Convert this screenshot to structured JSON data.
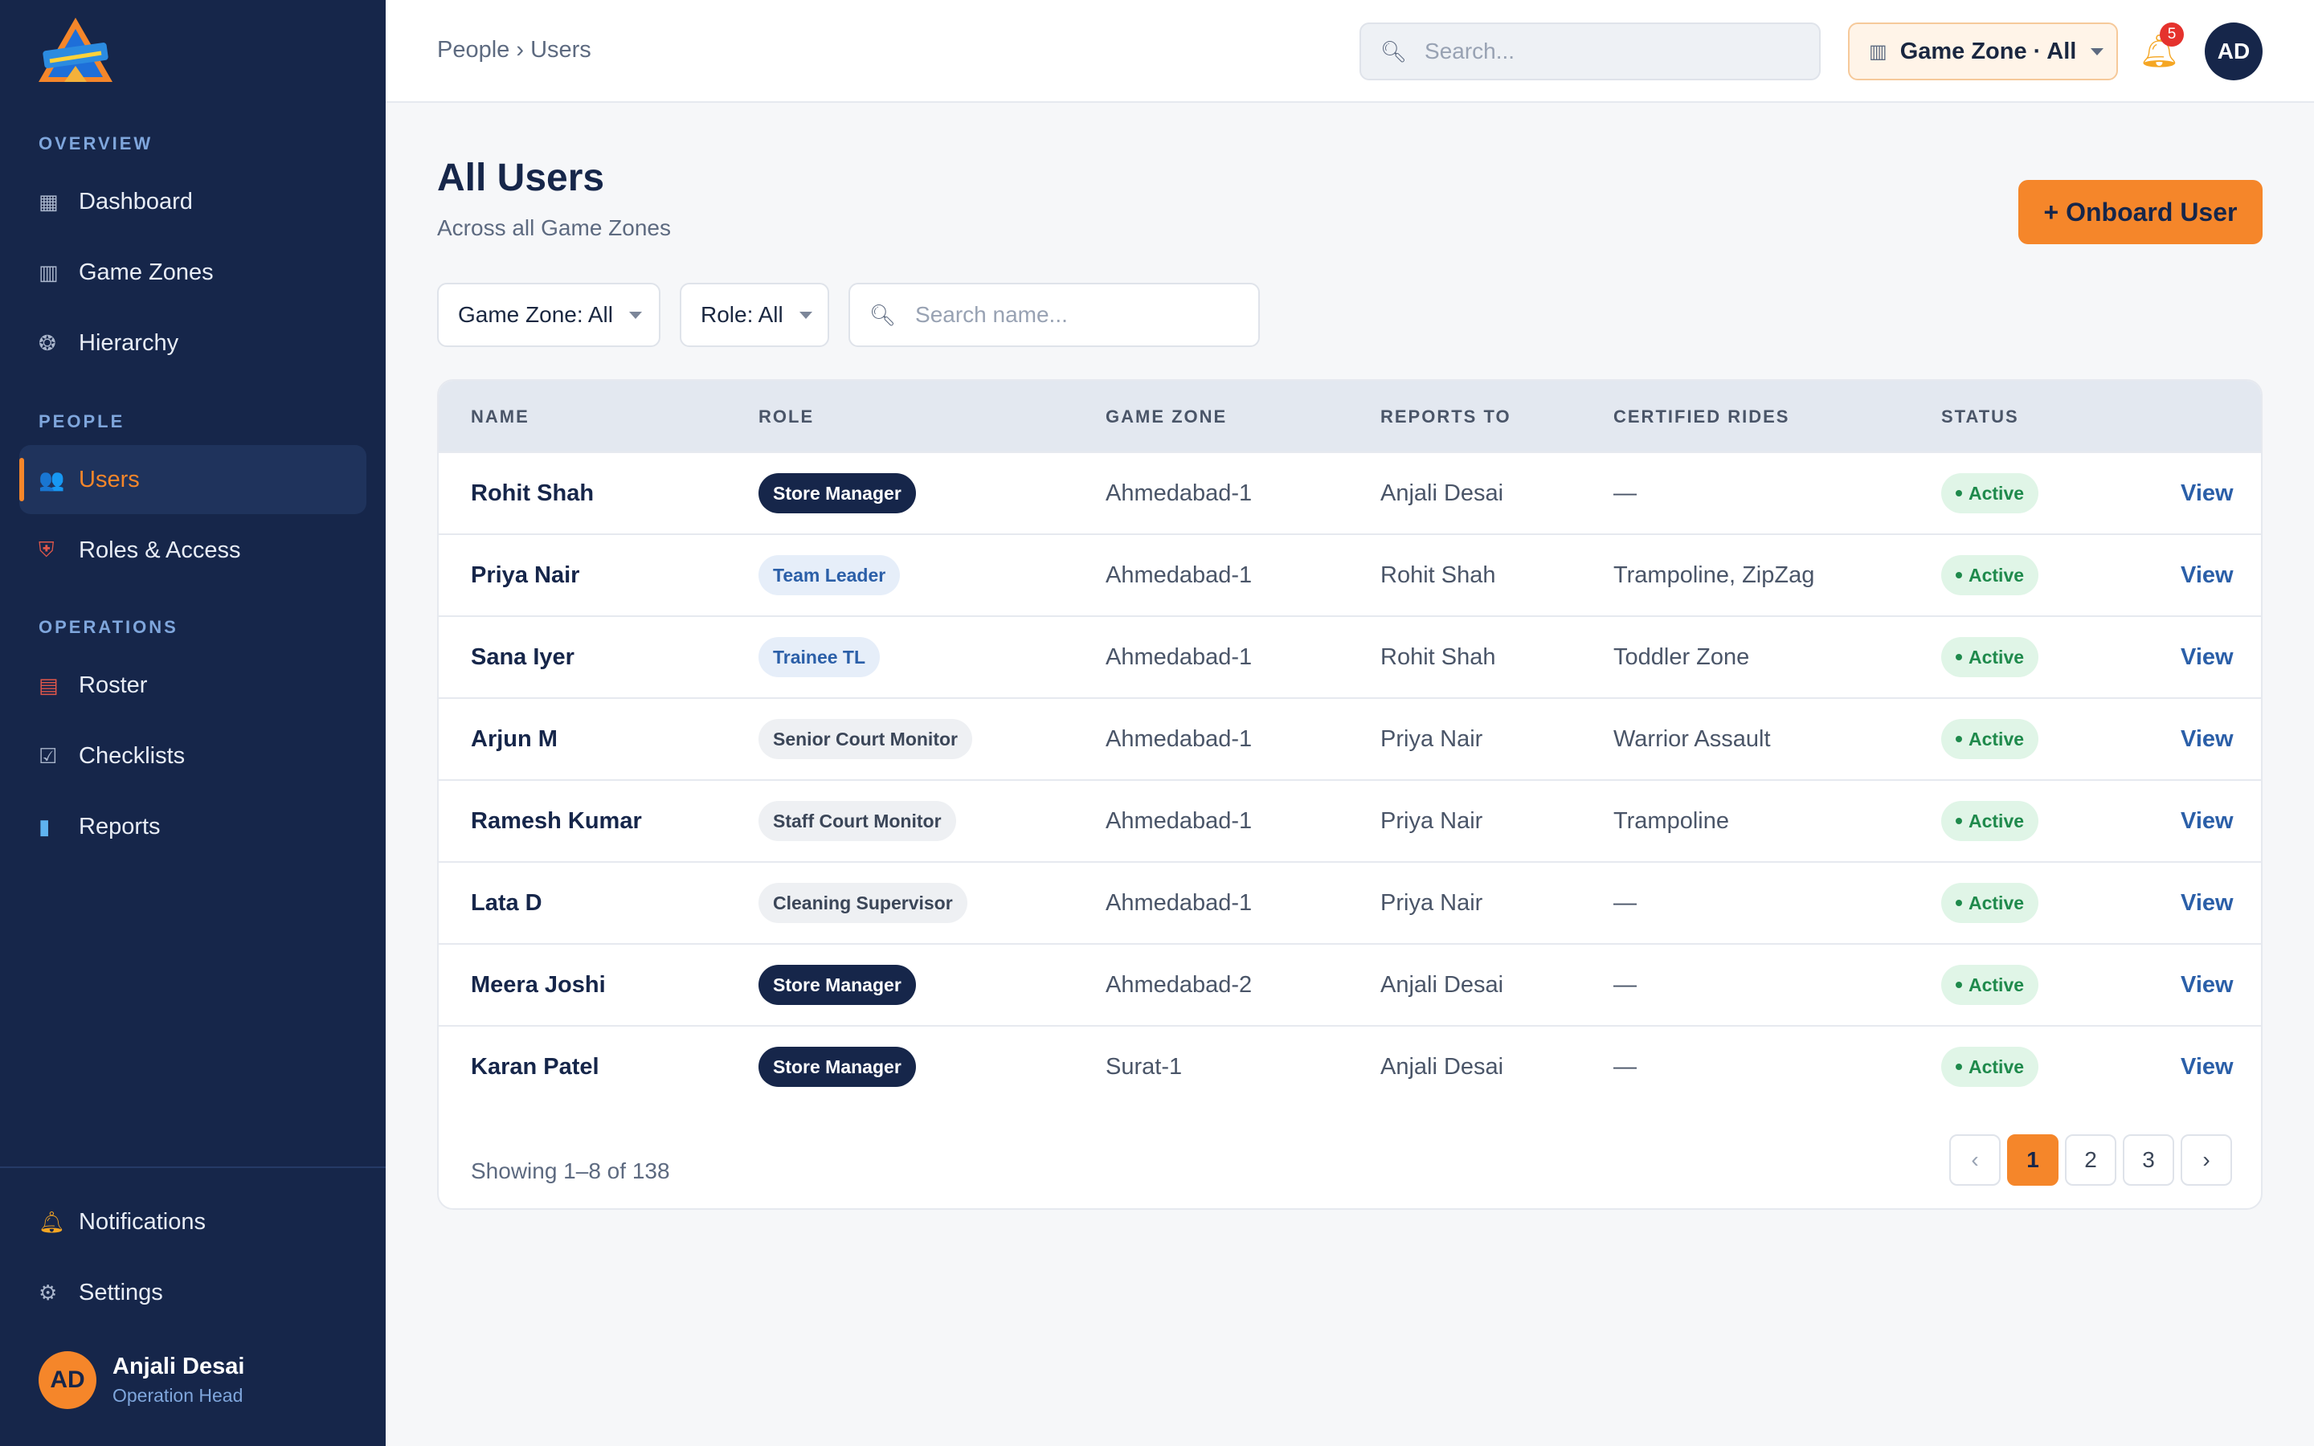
{
  "sidebar": {
    "sections": {
      "overview": "OVERVIEW",
      "people": "PEOPLE",
      "operations": "OPERATIONS"
    },
    "items": {
      "dashboard": "Dashboard",
      "game_zones": "Game Zones",
      "hierarchy": "Hierarchy",
      "users": "Users",
      "roles_access": "Roles & Access",
      "roster": "Roster",
      "checklists": "Checklists",
      "reports": "Reports",
      "notifications": "Notifications",
      "settings": "Settings"
    },
    "profile": {
      "initials": "AD",
      "name": "Anjali Desai",
      "role": "Operation Head"
    }
  },
  "header": {
    "breadcrumb": "People › Users",
    "search_placeholder": "Search...",
    "zone_selector": "Game Zone · All",
    "notification_count": "5",
    "avatar_initials": "AD"
  },
  "page": {
    "title": "All Users",
    "subtitle": "Across all Game Zones",
    "onboard_button": "+ Onboard User"
  },
  "filters": {
    "game_zone": "Game Zone: All",
    "role": "Role: All",
    "search_placeholder": "Search name..."
  },
  "table": {
    "columns": [
      "NAME",
      "ROLE",
      "GAME ZONE",
      "REPORTS TO",
      "CERTIFIED RIDES",
      "STATUS"
    ],
    "view_label": "View",
    "rows": [
      {
        "name": "Rohit Shah",
        "role": "Store Manager",
        "role_style": "dark",
        "zone": "Ahmedabad-1",
        "reports_to": "Anjali Desai",
        "rides": "—",
        "status": "Active"
      },
      {
        "name": "Priya Nair",
        "role": "Team Leader",
        "role_style": "blue",
        "zone": "Ahmedabad-1",
        "reports_to": "Rohit Shah",
        "rides": "Trampoline, ZipZag",
        "status": "Active"
      },
      {
        "name": "Sana Iyer",
        "role": "Trainee TL",
        "role_style": "blue",
        "zone": "Ahmedabad-1",
        "reports_to": "Rohit Shah",
        "rides": "Toddler Zone",
        "status": "Active"
      },
      {
        "name": "Arjun M",
        "role": "Senior Court Monitor",
        "role_style": "grey",
        "zone": "Ahmedabad-1",
        "reports_to": "Priya Nair",
        "rides": "Warrior Assault",
        "status": "Active"
      },
      {
        "name": "Ramesh Kumar",
        "role": "Staff Court Monitor",
        "role_style": "grey",
        "zone": "Ahmedabad-1",
        "reports_to": "Priya Nair",
        "rides": "Trampoline",
        "status": "Active"
      },
      {
        "name": "Lata D",
        "role": "Cleaning Supervisor",
        "role_style": "grey",
        "zone": "Ahmedabad-1",
        "reports_to": "Priya Nair",
        "rides": "—",
        "status": "Active"
      },
      {
        "name": "Meera Joshi",
        "role": "Store Manager",
        "role_style": "dark",
        "zone": "Ahmedabad-2",
        "reports_to": "Anjali Desai",
        "rides": "—",
        "status": "Active"
      },
      {
        "name": "Karan Patel",
        "role": "Store Manager",
        "role_style": "dark",
        "zone": "Surat-1",
        "reports_to": "Anjali Desai",
        "rides": "—",
        "status": "Active"
      }
    ],
    "footer": "Showing 1–8 of 138",
    "pagination": {
      "prev": "‹",
      "pages": [
        "1",
        "2",
        "3"
      ],
      "current": "1",
      "next": "›"
    }
  },
  "colors": {
    "sidebar_bg": "#16264a",
    "accent": "#f5862a",
    "link": "#2b5fa8",
    "status_active": "#1f8a4c"
  }
}
